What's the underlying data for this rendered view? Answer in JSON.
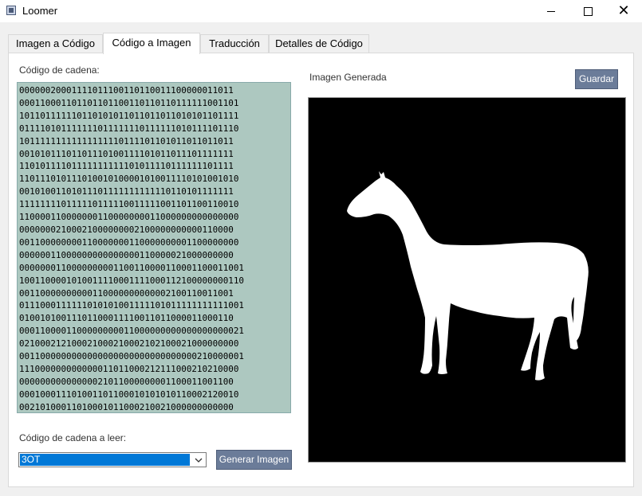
{
  "window": {
    "title": "Loomer"
  },
  "tabs": [
    {
      "label": "Imagen a Código"
    },
    {
      "label": "Código a Imagen"
    },
    {
      "label": "Traducción"
    },
    {
      "label": "Detalles de Código"
    }
  ],
  "left": {
    "code_label": "Código de cadena:",
    "code_lines": [
      "0000002000111101110011011001110000001101 1",
      "0001100011011011011001101101101111110011 01",
      "1011011111101101010110110110110101011011 11",
      "0111101011111110111111101111110101111011 10",
      "1011111111111111111011110110101101101101 1",
      "0010101110110111010011110101101110111111 1",
      "1101011110111111111110101111011111110111 1",
      "1101110101110100101000010100111101010010 10",
      "0010100110101110111111111111011010111111 1",
      "1111111101111101111100111110011011001100 10",
      "1100001100000001100000000110000000000000 00",
      "0000000210002100000000210000000000011000 0",
      "0011000000001100000001100000000011000000 00",
      "0000001100000000000000011000002100000000 0",
      "0000000110000000001100110000110001100011 001",
      "1001100001010011110001111000112100000000 110",
      "0011000000000011000000000000210011001100 1",
      "0111000111111010101001111101011111111111 001",
      "0100101001110110001111001101100001100011 0",
      "0001100001100000000011000000000000000000 021",
      "0210002121000210002100021021000210000000 00",
      "0011000000000000000000000000000000210000 001",
      "1110000000000000110110002121110002102100 00",
      "0000000000000002101100000000110001100110 0",
      "0001000111010011011000101010101100021200 10",
      "0021010001101000101100021002100000000000 0"
    ],
    "read_label": "Código de cadena a leer:",
    "selected_value": "3OT",
    "generate_label": "Generar Imagen"
  },
  "right": {
    "image_label": "Imagen Generada",
    "save_label": "Guardar"
  }
}
